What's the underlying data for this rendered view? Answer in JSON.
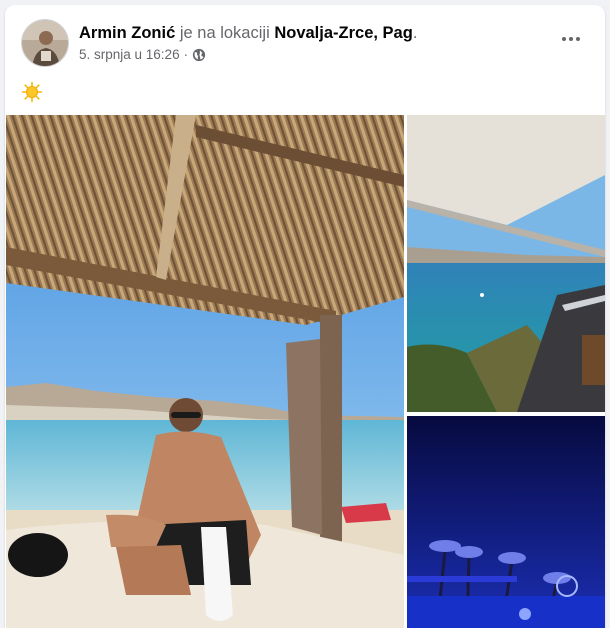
{
  "post": {
    "author_name": "Armin Zonić",
    "location_connector": " je na lokaciji ",
    "location_name": "Novalja-Zrce, Pag",
    "trailing_punct": ".",
    "timestamp": "5. srpnja u 16:26",
    "separator": "·",
    "audience_icon": "globe-icon",
    "caption_icon": "sun-emoji"
  },
  "colors": {
    "name_text": "#050505",
    "secondary_text": "#65676b",
    "card_background": "#ffffff",
    "page_background": "#f0f2f5"
  },
  "photos": [
    {
      "name": "beach-cabana-photo"
    },
    {
      "name": "sea-terrace-view-photo"
    },
    {
      "name": "night-palm-lights-photo"
    }
  ]
}
